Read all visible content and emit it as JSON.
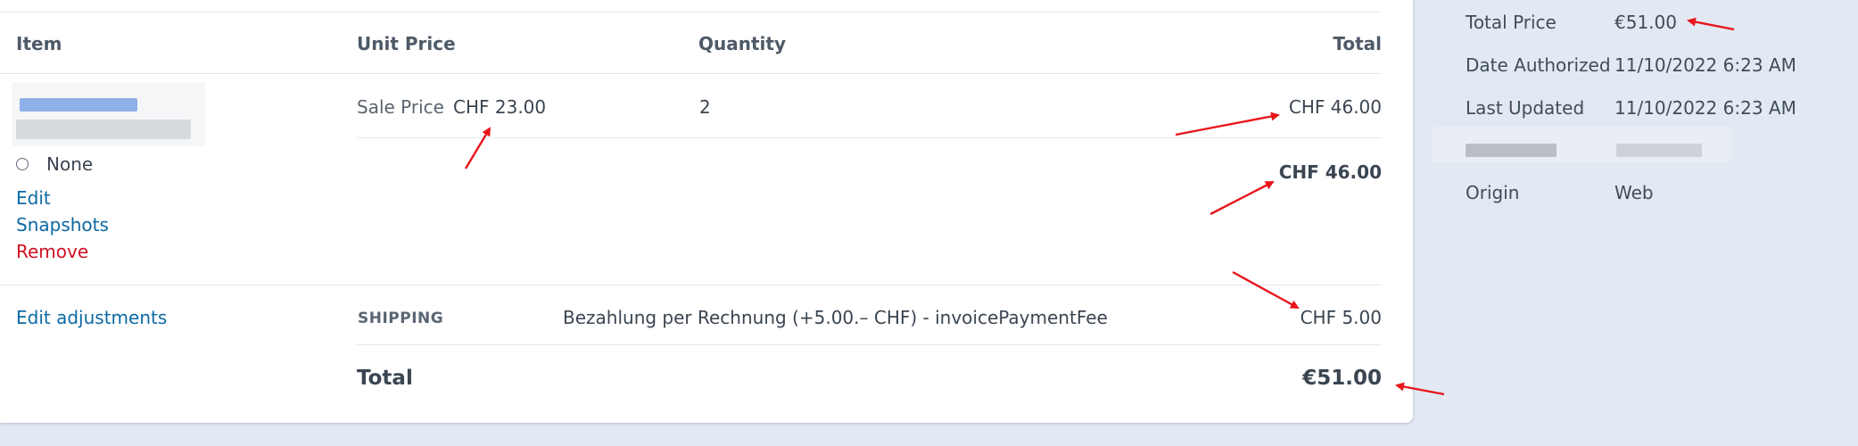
{
  "table": {
    "headers": {
      "item": "Item",
      "unit_price": "Unit Price",
      "quantity": "Quantity",
      "total": "Total"
    },
    "line_item": {
      "price_label": "Sale Price",
      "unit_price": "CHF 23.00",
      "quantity": "2",
      "line_total": "CHF 46.00",
      "subtotal": "CHF 46.00",
      "option_label": "None",
      "actions": {
        "edit": "Edit",
        "snapshots": "Snapshots",
        "remove": "Remove"
      }
    },
    "adjustments": {
      "edit_link": "Edit adjustments",
      "type": "SHIPPING",
      "description": "Bezahlung per Rechnung (+5.00.– CHF) - invoicePaymentFee",
      "amount": "CHF 5.00"
    },
    "grand_total": {
      "label": "Total",
      "value": "€51.00"
    }
  },
  "sidebar": {
    "rows": [
      {
        "label": "Total Price",
        "value": "€51.00"
      },
      {
        "label": "Date Authorized",
        "value": "11/10/2022 6:23 AM"
      },
      {
        "label": "Last Updated",
        "value": "11/10/2022 6:23 AM"
      },
      {
        "label": "",
        "value": ""
      },
      {
        "label": "Origin",
        "value": "Web"
      }
    ]
  },
  "colors": {
    "link": "#0b69a3",
    "danger": "#cf1124",
    "annotation_arrow": "#e8161b",
    "sidebar_bg": "#e3e9f2"
  }
}
